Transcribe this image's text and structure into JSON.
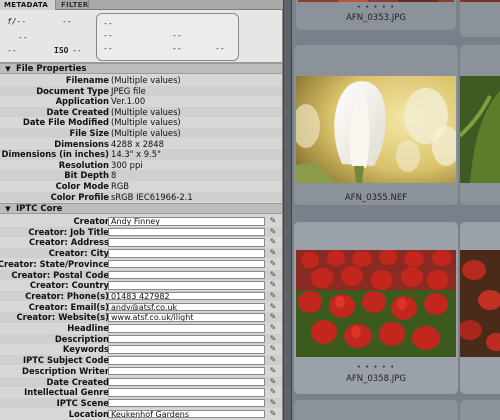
{
  "tabs": {
    "metadata": "METADATA",
    "filter": "FILTER"
  },
  "camera_data": {
    "aperture": "f/--",
    "shutter": "--",
    "d1": "--",
    "d2": "--",
    "iso_label": "ISO",
    "iso_value": "--",
    "r1": "--",
    "r2": "--",
    "r3": "--",
    "r4": "--",
    "r5": "--",
    "r6": "--"
  },
  "file_properties": {
    "title": "File Properties",
    "rows": [
      {
        "label": "Filename",
        "value": "(Multiple values)"
      },
      {
        "label": "Document Type",
        "value": "JPEG file"
      },
      {
        "label": "Application",
        "value": "Ver.1.00"
      },
      {
        "label": "Date Created",
        "value": "(Multiple values)"
      },
      {
        "label": "Date File Modified",
        "value": "(Multiple values)"
      },
      {
        "label": "File Size",
        "value": "(Multiple values)"
      },
      {
        "label": "Dimensions",
        "value": "4288 x 2848"
      },
      {
        "label": "Dimensions (in inches)",
        "value": "14.3\" x 9.5\""
      },
      {
        "label": "Resolution",
        "value": "300 ppi"
      },
      {
        "label": "Bit Depth",
        "value": "8"
      },
      {
        "label": "Color Mode",
        "value": "RGB"
      },
      {
        "label": "Color Profile",
        "value": "sRGB IEC61966-2.1"
      }
    ]
  },
  "iptc_core": {
    "title": "IPTC Core",
    "rows": [
      {
        "label": "Creator",
        "value": "Andy Finney"
      },
      {
        "label": "Creator: Job Title",
        "value": ""
      },
      {
        "label": "Creator: Address",
        "value": ""
      },
      {
        "label": "Creator: City",
        "value": ""
      },
      {
        "label": "Creator: State/Province",
        "value": ""
      },
      {
        "label": "Creator: Postal Code",
        "value": ""
      },
      {
        "label": "Creator: Country",
        "value": ""
      },
      {
        "label": "Creator: Phone(s)",
        "value": "01483 427982"
      },
      {
        "label": "Creator: Email(s)",
        "value": "andy@atsf.co.uk"
      },
      {
        "label": "Creator: Website(s)",
        "value": "www.atsf.co.uk/ilight"
      },
      {
        "label": "Headline",
        "value": ""
      },
      {
        "label": "Description",
        "value": ""
      },
      {
        "label": "Keywords",
        "value": ""
      },
      {
        "label": "IPTC Subject Code",
        "value": ""
      },
      {
        "label": "Description Writer",
        "value": ""
      },
      {
        "label": "Date Created",
        "value": ""
      },
      {
        "label": "Intellectual Genre",
        "value": ""
      },
      {
        "label": "IPTC Scene",
        "value": ""
      },
      {
        "label": "Location",
        "value": "Keukenhof Gardens"
      }
    ]
  },
  "thumbnails": [
    {
      "filename": "AFN_0353.JPG",
      "dots": "• • • • •"
    },
    {
      "filename": "AFN_0355.NEF",
      "dots": "• • • • •"
    },
    {
      "filename": "AFN_0358.JPG",
      "dots": "• • • • •"
    }
  ],
  "colors": {
    "panel_bg": "#d7d7d7",
    "section_header": "#bcbcbc",
    "thumb_area": "#79808a",
    "cell_selected": "#9aa1a8"
  }
}
